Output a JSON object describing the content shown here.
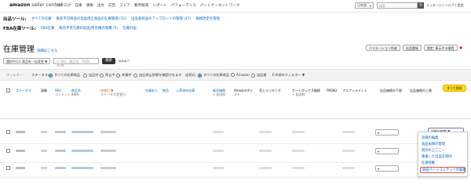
{
  "header": {
    "brand": "amazon",
    "brand_suffix": "seller central",
    "nav": [
      "カタログ",
      "在庫",
      "価格",
      "注文",
      "広告",
      "ストア",
      "数字販売",
      "レポート",
      "パフォーマンス",
      "パートナーネットワーク"
    ],
    "language": "日本語",
    "search_placeholder": "検索",
    "links": "メッセージ | ヘルプ | 設定"
  },
  "tools1": {
    "label": "出品ツール:",
    "links": [
      "すべての在庫",
      "販売不可商品の出品停止商品の在庫管理 (11)",
      "出品者商品のアップロードの管理 (47)",
      "価格改定を管理"
    ]
  },
  "tools2": {
    "label": "FBA在庫ツール:",
    "links": [
      "FBA在庫",
      "販売不可在庫の返品/所有権の放棄 (5)",
      "在庫計画"
    ]
  },
  "page": {
    "title": "在庫管理",
    "learn_more": "詳細はこちら",
    "buttons": [
      "バリエーション作成",
      "出品登録",
      "設定: 表示する項目",
      "●"
    ]
  },
  "toolbar": {
    "bulk_action": "選択中の1 商品を一括変更 ▼",
    "search_placeholder": "SKU、製品名、ISBN、ASIN",
    "search_button": "検索",
    "result_count": "●●●件"
  },
  "filters": {
    "label": "フィルター:",
    "status_label": "ステータス:",
    "status_opts": [
      "すべての在庫商品",
      "出品中",
      "停止中",
      "休業中",
      "出品停止状態を確認されます"
    ],
    "fulfill_label": "出荷元:",
    "fulfill_opts": [
      "すべての在庫商品",
      "Amazon",
      "出品者"
    ],
    "more_filters": "その他のフィルター ▼"
  },
  "columns": {
    "status": "ステータス",
    "image": "画像",
    "sku": "SKU",
    "sku_sub": "コンディション",
    "product": "商品名",
    "product_sub": "ASIN",
    "created": "作成日 ▼",
    "created_sub": "ステータス変更日",
    "available": "在庫あり",
    "fee": "物品",
    "inbound": "入荷済み在庫",
    "price": "販売価格",
    "price_sub": "+ 配送料",
    "amazon_points": "Amazonポイント",
    "sales_rank": "売上ランキング",
    "cart_price": "カートボックス価格",
    "cart_sub": "+ 配送料",
    "fnsku": "FNSKU",
    "fulfillment": "フルフィルメント",
    "lowest_price": "出品価格の下限",
    "max_price": "出品価格の上限",
    "hide_button": "すべて保存"
  },
  "row_dropdown": "詳細の編集 ▼",
  "menu": {
    "items": [
      "詳細の編集",
      "商品画像の管理",
      "削除の上ここ一",
      "重複した出品を削除",
      "在庫移動",
      "商品ページコンテンツの編集"
    ]
  }
}
